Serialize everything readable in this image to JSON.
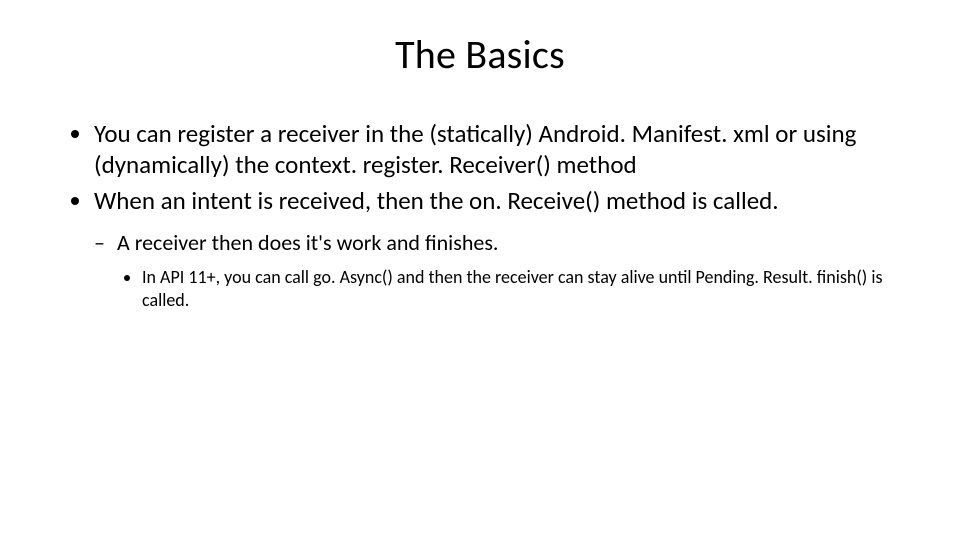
{
  "title": "The Basics",
  "bullets": {
    "b1": "You can register a receiver in the (statically) Android. Manifest. xml or using (dynamically) the context. register. Receiver() method",
    "b2": "When an intent is received, then the on. Receive() method is called.",
    "b2_sub1": "A receiver then does it's work and finishes.",
    "b2_sub1_sub1": "In API 11+, you can call go. Async() and then the receiver can stay alive until Pending. Result. finish() is called."
  }
}
